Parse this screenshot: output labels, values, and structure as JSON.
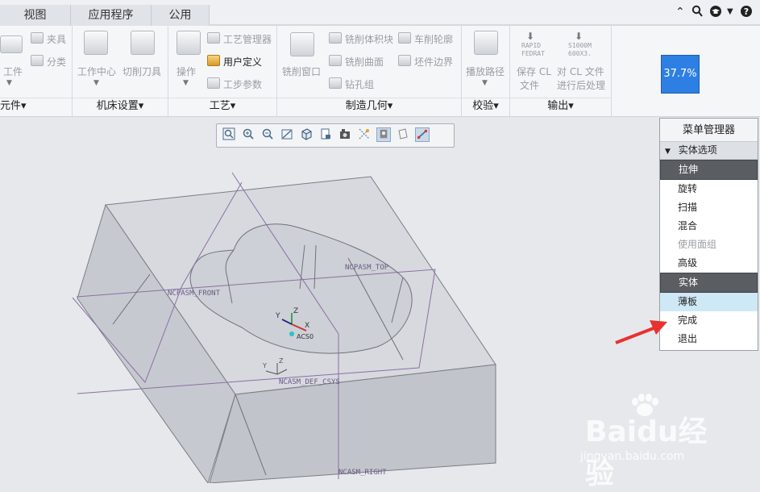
{
  "tabs": [
    "视图",
    "应用程序",
    "公用"
  ],
  "topright_icons": [
    "collapse-up-icon",
    "search-icon",
    "graduation-cap-icon",
    "dropdown-icon",
    "help-icon"
  ],
  "ribbon": {
    "groups": {
      "part": {
        "label": "元件▾",
        "items": {
          "workpiece": "工件",
          "fixture": "夹具",
          "classify": "分类"
        }
      },
      "machine": {
        "label": "机床设置▾",
        "items": {
          "work_center": "工作中心",
          "cutting_tool": "切削刀具"
        }
      },
      "process": {
        "label": "工艺▾",
        "items": {
          "operation": "操作",
          "process_manager": "工艺管理器",
          "user_defined": "用户定义",
          "step_params": "工步参数"
        }
      },
      "mfg_geometry": {
        "label": "制造几何▾",
        "items": {
          "mill_window": "铣削窗口",
          "mill_volume": "铣削体积块",
          "mill_surface": "铣削曲面",
          "drill_group": "钻孔组",
          "turn_profile": "车削轮廓",
          "stock_boundary": "坯件边界"
        }
      },
      "verify": {
        "label": "校验▾",
        "items": {
          "play_path": "播放路径"
        }
      },
      "output": {
        "label": "输出▾",
        "items": {
          "rapid": "RAPID",
          "fedrat": "FEDRAT",
          "s1000": "S1000M",
          "s600": "600X3.",
          "save_cl": "保存 CL",
          "save_cl2": "文件",
          "post_cl": "对 CL 文件",
          "post_cl2": "进行后处理"
        }
      }
    },
    "progress": "37.7%"
  },
  "graphics_toolbar": {
    "icons": [
      "refit-icon",
      "zoom-in-icon",
      "zoom-out-icon",
      "repaint-icon",
      "display-style-icon",
      "saved-orientations-icon",
      "view-manager-icon",
      "annotation-display-icon",
      "datum-display-icon",
      "spin-center-icon",
      "perspective-icon",
      "csys-display-icon"
    ]
  },
  "model": {
    "labels": {
      "top": "NCPASM_TOP",
      "front": "NCPASM_FRONT",
      "right": "NCASM_RIGHT",
      "csys": "NCASM_DEF_CSYS",
      "acs": "ACS0",
      "x": "X",
      "y": "Y",
      "z": "Z"
    }
  },
  "menu_manager": {
    "title": "菜单管理器",
    "section": "实体选项",
    "items": [
      "拉伸",
      "旋转",
      "扫描",
      "混合",
      "使用面组",
      "高级",
      "实体",
      "薄板",
      "完成",
      "退出"
    ]
  },
  "watermark": {
    "main": "Baidu经验",
    "sub": "jingyan.baidu.com"
  },
  "colors": {
    "accent": "#2d7fe3",
    "arrow": "#e8322f",
    "menu_highlight": "#5a5d62",
    "menu_hover": "#cfe8f6"
  }
}
